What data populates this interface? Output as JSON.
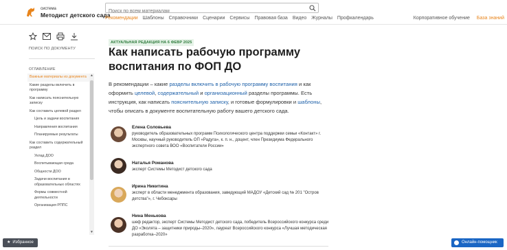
{
  "header": {
    "logo_small": "система",
    "logo_big": "Методист детского сада",
    "search_placeholder": "Поиск по всем материалам",
    "nav": [
      "Рекомендации",
      "Шаблоны",
      "Справочники",
      "Сценарии",
      "Сервисы",
      "Правовая база",
      "Видео",
      "Журналы",
      "Профкалендарь"
    ],
    "nav_right": [
      "Корпоративное обучение",
      "База знаний"
    ]
  },
  "sidebar": {
    "doc_heading": "ПОИСК ПО ДОКУМЕНТУ",
    "toc_heading": "ОГЛАВЛЕНИЕ",
    "toc": [
      {
        "label": "Важные материалы из документа",
        "active": true,
        "sub": false
      },
      {
        "label": "Какие разделы включить в программу",
        "active": false,
        "sub": false
      },
      {
        "label": "Как написать пояснительную записку",
        "active": false,
        "sub": false
      },
      {
        "label": "Как составить целевой раздел",
        "active": false,
        "sub": false
      },
      {
        "label": "Цель и задачи воспитания",
        "active": false,
        "sub": true
      },
      {
        "label": "Направления воспитания",
        "active": false,
        "sub": true
      },
      {
        "label": "Планируемые результаты",
        "active": false,
        "sub": true
      },
      {
        "label": "Как составить содержательный раздел",
        "active": false,
        "sub": false
      },
      {
        "label": "Уклад ДОО",
        "active": false,
        "sub": true
      },
      {
        "label": "Воспитывающая среда",
        "active": false,
        "sub": true
      },
      {
        "label": "Общности ДОО",
        "active": false,
        "sub": true
      },
      {
        "label": "Задачи воспитания в образовательных областях",
        "active": false,
        "sub": true
      },
      {
        "label": "Формы совместной деятельности",
        "active": false,
        "sub": true
      },
      {
        "label": "Организация РППС",
        "active": false,
        "sub": true
      }
    ]
  },
  "main": {
    "badge": "АКТУАЛЬНАЯ РЕДАКЦИЯ НА 6 ФЕВР 2025",
    "title": "Как написать рабочую программу воспитания по ФОП ДО",
    "intro": [
      {
        "t": "В рекомендации – какие ",
        "link": false
      },
      {
        "t": "разделы включить в рабочую программу воспитания",
        "link": true
      },
      {
        "t": " и как оформить ",
        "link": false
      },
      {
        "t": "целевой",
        "link": true
      },
      {
        "t": ", ",
        "link": false
      },
      {
        "t": "содержательный",
        "link": true
      },
      {
        "t": " и ",
        "link": false
      },
      {
        "t": "организационный",
        "link": true
      },
      {
        "t": " разделы программы. Есть инструкция, как написать ",
        "link": false
      },
      {
        "t": "пояснительную записку",
        "link": true
      },
      {
        "t": ", и готовые формулировки и ",
        "link": false
      },
      {
        "t": "шаблоны",
        "link": true
      },
      {
        "t": ", чтобы описать в документе воспитательную работу вашего детского сада.",
        "link": false
      }
    ],
    "authors": [
      {
        "name": "Елена  Соловьева",
        "desc": "руководитель образовательных программ Психологического центра поддержки семьи «Контакт» г. Москвы, научный руководитель ОП «Радуга», к. п. н., доцент, член Президиума Федерального экспертного совета ВОО «Воспитатели России»"
      },
      {
        "name": "Наталья Романова",
        "desc": "эксперт Системы Методист детского сада"
      },
      {
        "name": "Ирина Никитина",
        "desc": "эксперт в области менеджмента образования, заведующий МАДОУ «Детский сад № 201 \"Остров детства\"», г. Чебоксары"
      },
      {
        "name": "Нина Менькова",
        "desc": "шеф редактор, эксперт Системы Методист детского сада, победитель Всероссийского конкурса среди ДО «Эколята – защитники природы–2020», лауреат Всероссийского конкурса «Лучшая методическая разработка–2020»"
      }
    ]
  },
  "buttons": {
    "favorites": "Избранное",
    "help": "Онлайн-помощник"
  },
  "colors": {
    "accent": "#e8841b",
    "link": "#1c5fa8",
    "help": "#1a66c4"
  }
}
